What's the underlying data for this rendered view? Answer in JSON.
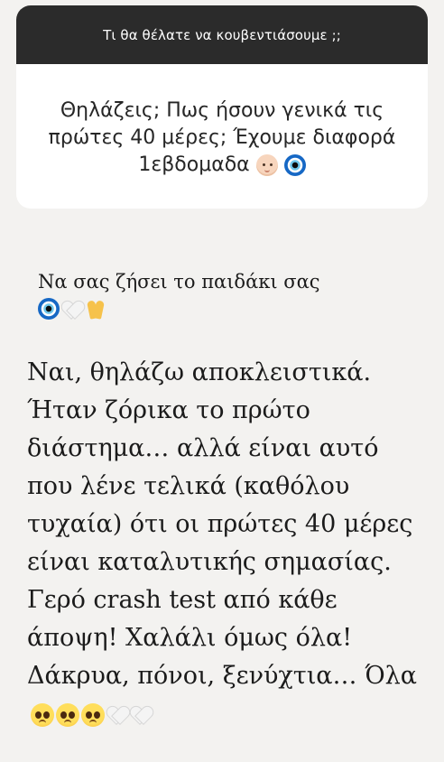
{
  "question_box": {
    "prompt": "Τι θα θέλατε να κουβεντιάσουμε ;;",
    "question": "Θηλάζεις; Πως ήσουν γενικά τις πρώτες 40 μέρες; Έχουμε διαφορά 1εβδομαδα",
    "question_emojis": [
      "baby-emoji",
      "nazar-amulet-emoji"
    ]
  },
  "reply": {
    "wish": "Να σας ζήσει το παιδάκι σας",
    "wish_emojis": [
      "nazar-amulet-emoji",
      "white-heart-emoji",
      "folded-hands-emoji"
    ],
    "answer": "Ναι, θηλάζω αποκλειστικά. Ήταν ζόρικα το πρώτο διάστημα… αλλά είναι αυτό που λένε τελικά (καθόλου τυχαία) ότι οι πρώτες 40 μέρες είναι καταλυτικής σημασίας. Γερό crash test από κάθε άποψη! Χαλάλι όμως όλα! Δάκρυα, πόνοι, ξενύχτια… Όλα",
    "answer_emojis": [
      "pleading-face-emoji",
      "pleading-face-emoji",
      "pleading-face-emoji",
      "white-heart-emoji",
      "white-heart-emoji"
    ]
  },
  "colors": {
    "background": "#f3f2f0",
    "header": "#2b2b2b",
    "card": "#ffffff",
    "text": "#1b1b1b"
  }
}
